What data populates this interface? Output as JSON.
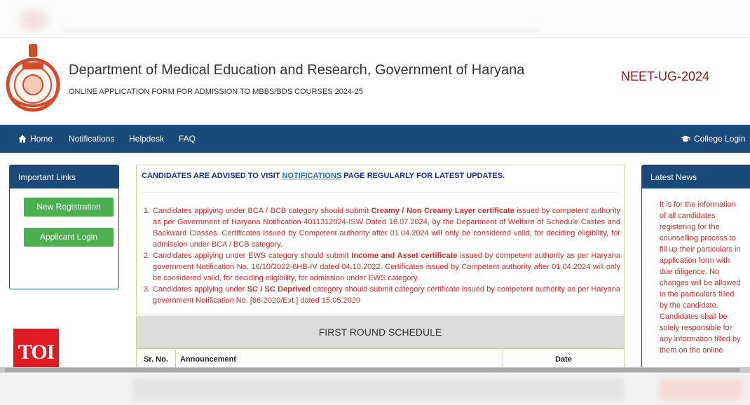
{
  "header": {
    "title": "Department of Medical Education and Research, Government of Haryana",
    "subtitle": "ONLINE APPLICATION FORM FOR ADMISSION TO MBBS/BDS COURSES 2024-25",
    "exam": "NEET-UG-2024",
    "emblem_icon": "haryana-emblem-icon"
  },
  "nav": {
    "home": "Home",
    "notifications": "Notifications",
    "helpdesk": "Helpdesk",
    "faq": "FAQ",
    "college_login": "College Login",
    "color": "#1b4a7a"
  },
  "important_links": {
    "title": "Important Links",
    "new_registration": "New Registration",
    "applicant_login": "Applicant Login",
    "button_color": "#4caf50"
  },
  "notice": {
    "heading_before": "CANDIDATES ARE ADVISED TO VISIT",
    "heading_link": "NOTIFICATIONS",
    "heading_after": "PAGE REGULARLY FOR LATEST UPDATES.",
    "items": [
      {
        "num": "1.",
        "pre": "Candidates applying under BCA / BCB category should submit",
        "bold": "Creamy / Non Creamy Layer certificate",
        "post": "issued by competent authority as per Government of Haryana Notification 4011312024-ISW Dated 16.07.2024, by the Department of Welfare of Schedule Castes and Backward Classes. Certificates issued by Competent authority after 01.04.2024 will only be considered valid, for deciding eligibility, for admission under BCA / BCB category."
      },
      {
        "num": "2.",
        "pre": "Candidates applying under EWS category should submit",
        "bold": "Income and Asset certificate",
        "post": "issued by competent authority as per Haryana government Notification No. 16/10/2022-6HB-IV dated 04.10.2022. Certificates issued by Competent authority after 01.04.2024 will only be considered valid, for deciding eligibility, for admission under EWS category."
      },
      {
        "num": "3.",
        "pre": "Candidates applying under",
        "bold": "SC / SC Deprived",
        "post": "category should submit category certificate issued by competent authority as per Haryana government Notification No. [66-2020/Ext.] dated 15.05.2020"
      }
    ],
    "text_color": "#d42b2b"
  },
  "schedule": {
    "title": "FIRST ROUND SCHEDULE",
    "columns": [
      "Sr. No.",
      "Announcement",
      "Date"
    ]
  },
  "latest_news": {
    "title": "Latest News",
    "text": "It is for the information of all candidates registering for the counselling process to fill up their particulars in application form with due diligence. No changes will be allowed in the particulars filled by the candidate. Candidates shall be solely responsible for any information filled by them on the online"
  },
  "watermark": {
    "logo_text": "TOI"
  }
}
